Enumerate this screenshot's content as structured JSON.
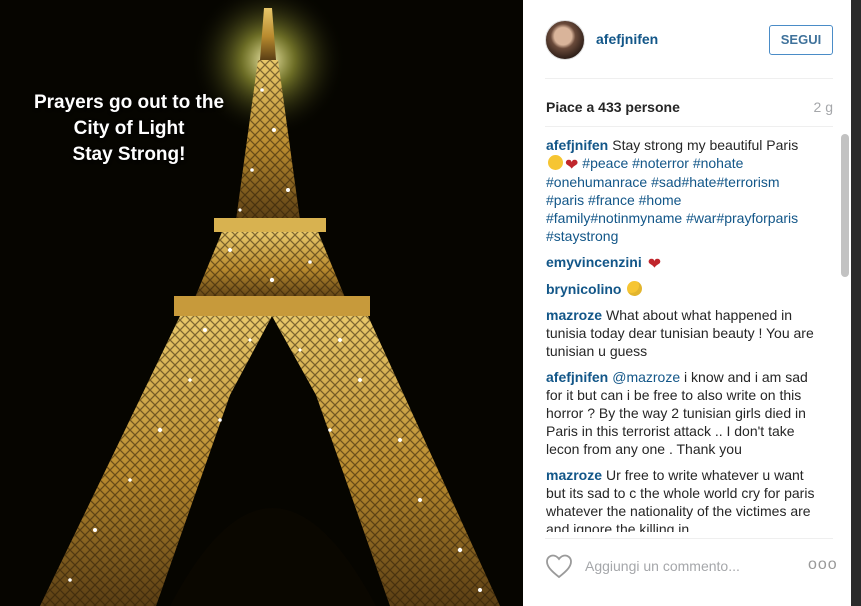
{
  "photo": {
    "overlay_lines": [
      "Prayers go out to the",
      "City of Light",
      "Stay Strong!"
    ]
  },
  "header": {
    "username": "afefjnifen",
    "follow_label": "SEGUI"
  },
  "stats": {
    "likes": "Piace a 433 persone",
    "age": "2 g"
  },
  "comments": [
    {
      "user": "afefjnifen",
      "parts": [
        {
          "t": "text",
          "v": "Stay strong my beautiful Paris "
        },
        {
          "t": "emoji",
          "v": "cry"
        },
        {
          "t": "emoji",
          "v": "heart"
        },
        {
          "t": "text",
          "v": " "
        },
        {
          "t": "tag",
          "v": "#peace"
        },
        {
          "t": "text",
          "v": " "
        },
        {
          "t": "tag",
          "v": "#noterror"
        },
        {
          "t": "text",
          "v": " "
        },
        {
          "t": "tag",
          "v": "#nohate"
        },
        {
          "t": "text",
          "v": " "
        },
        {
          "t": "tag",
          "v": "#onehumanrace"
        },
        {
          "t": "text",
          "v": " "
        },
        {
          "t": "tag",
          "v": "#sad"
        },
        {
          "t": "tag",
          "v": "#hate"
        },
        {
          "t": "tag",
          "v": "#terrorism"
        },
        {
          "t": "text",
          "v": " "
        },
        {
          "t": "tag",
          "v": "#paris"
        },
        {
          "t": "text",
          "v": " "
        },
        {
          "t": "tag",
          "v": "#france"
        },
        {
          "t": "text",
          "v": " "
        },
        {
          "t": "tag",
          "v": "#home"
        },
        {
          "t": "text",
          "v": " "
        },
        {
          "t": "tag",
          "v": "#family"
        },
        {
          "t": "tag",
          "v": "#notinmyname"
        },
        {
          "t": "text",
          "v": " "
        },
        {
          "t": "tag",
          "v": "#war"
        },
        {
          "t": "tag",
          "v": "#prayforparis"
        },
        {
          "t": "text",
          "v": " "
        },
        {
          "t": "tag",
          "v": "#staystrong"
        }
      ]
    },
    {
      "user": "emyvincenzini",
      "parts": [
        {
          "t": "emoji",
          "v": "heart"
        }
      ]
    },
    {
      "user": "brynicolino",
      "parts": [
        {
          "t": "emoji",
          "v": "sweat"
        }
      ]
    },
    {
      "user": "mazroze",
      "parts": [
        {
          "t": "text",
          "v": "What about what happened in tunisia today dear tunisian beauty ! You are tunisian u guess"
        }
      ]
    },
    {
      "user": "afefjnifen",
      "parts": [
        {
          "t": "tag",
          "v": "@mazroze"
        },
        {
          "t": "text",
          "v": " i know and i am sad for it but can i be free to also write on this horror ? By the way 2 tunisian girls died in Paris in this terrorist attack .. I don't take lecon from any one . Thank you"
        }
      ]
    },
    {
      "user": "mazroze",
      "parts": [
        {
          "t": "text",
          "v": "Ur free to write whatever u want but its sad to c the whole world cry for paris whatever the nationality of the victimes are and ignore the killing in"
        }
      ]
    }
  ],
  "footer": {
    "add_comment_placeholder": "Aggiungi un commento...",
    "more_label": "ooo"
  },
  "colors": {
    "link": "#125688",
    "follow_border": "#4a8cc7",
    "muted": "#a5a7aa"
  }
}
